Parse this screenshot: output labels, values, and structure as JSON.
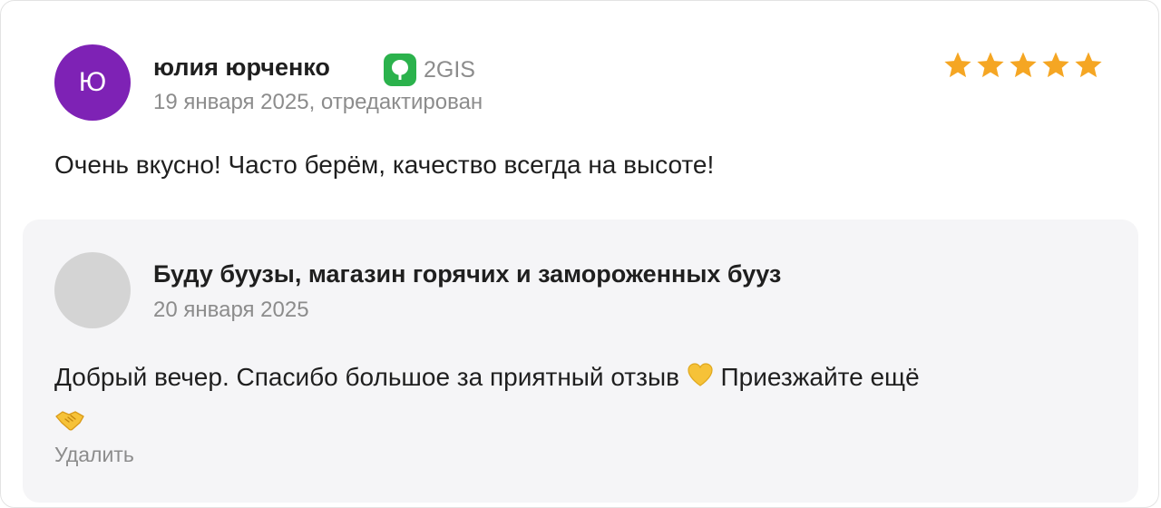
{
  "review": {
    "author_initial": "Ю",
    "author_name": "юлия юрченко",
    "source_label": "2GIS",
    "date": "19 января 2025, отредактирован",
    "rating": 5,
    "rating_max": 5,
    "text": "Очень вкусно! Часто берём, качество всегда на высоте!",
    "avatar_color": "#7e22b5",
    "star_color": "#f5a623",
    "source_color": "#2bb24c"
  },
  "reply": {
    "author_name": "Буду буузы, магазин горячих и замороженных бууз",
    "date": "20 января 2025",
    "text_before": "Добрый вечер. Спасибо большое за приятный отзыв",
    "text_after": "Приезжайте ещё",
    "emojis": [
      "yellow-heart-icon",
      "handshake-icon"
    ],
    "delete_label": "Удалить"
  }
}
